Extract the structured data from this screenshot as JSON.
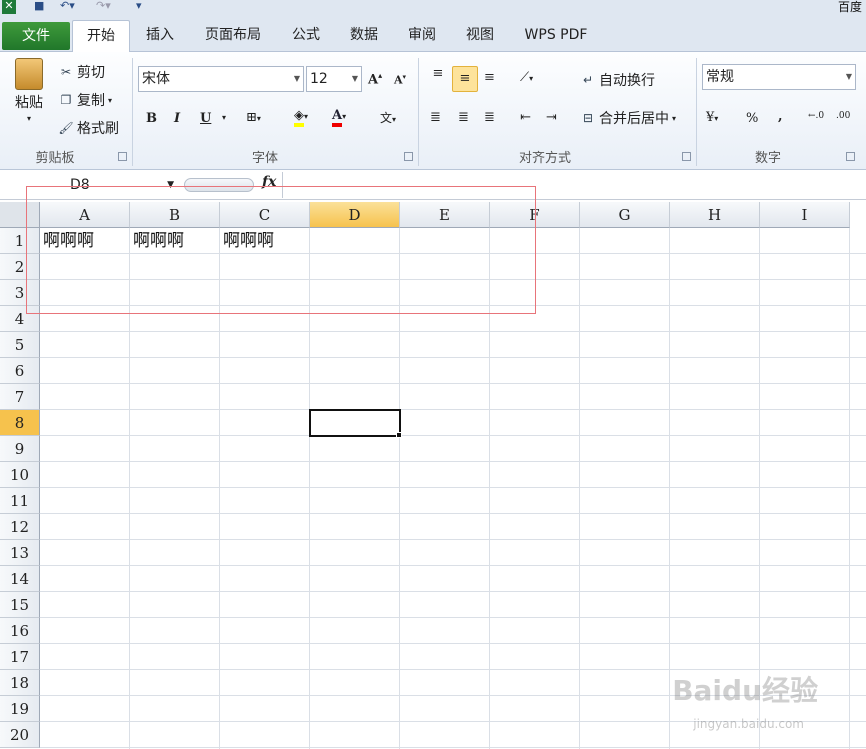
{
  "window": {
    "title_fragment": "百度"
  },
  "tabs": [
    "文件",
    "开始",
    "插入",
    "页面布局",
    "公式",
    "数据",
    "审阅",
    "视图",
    "WPS PDF"
  ],
  "clipboard": {
    "paste": "粘贴",
    "cut": "剪切",
    "copy": "复制",
    "format_painter": "格式刷",
    "label": "剪贴板"
  },
  "font": {
    "name": "宋体",
    "size": "12",
    "label": "字体",
    "bold": "B",
    "italic": "I",
    "underline": "U"
  },
  "align": {
    "wrap": "自动换行",
    "merge": "合并后居中",
    "label": "对齐方式"
  },
  "number": {
    "format": "常规",
    "percent": "%",
    "comma": ",",
    "label": "数字"
  },
  "formula_bar": {
    "name_box": "D8",
    "fx": "fx",
    "value": ""
  },
  "grid": {
    "columns": [
      "A",
      "B",
      "C",
      "D",
      "E",
      "F",
      "G",
      "H",
      "I"
    ],
    "rows": [
      "1",
      "2",
      "3",
      "4",
      "5",
      "6",
      "7",
      "8",
      "9",
      "10",
      "11",
      "12",
      "13",
      "14",
      "15",
      "16",
      "17",
      "18",
      "19",
      "20"
    ],
    "selected_column": "D",
    "selected_row": "8",
    "cells": {
      "A1": "啊啊啊",
      "B1": "啊啊啊",
      "C1": "啊啊啊"
    }
  },
  "watermark": {
    "brand": "Baidu经验",
    "url": "jingyan.baidu.com"
  }
}
